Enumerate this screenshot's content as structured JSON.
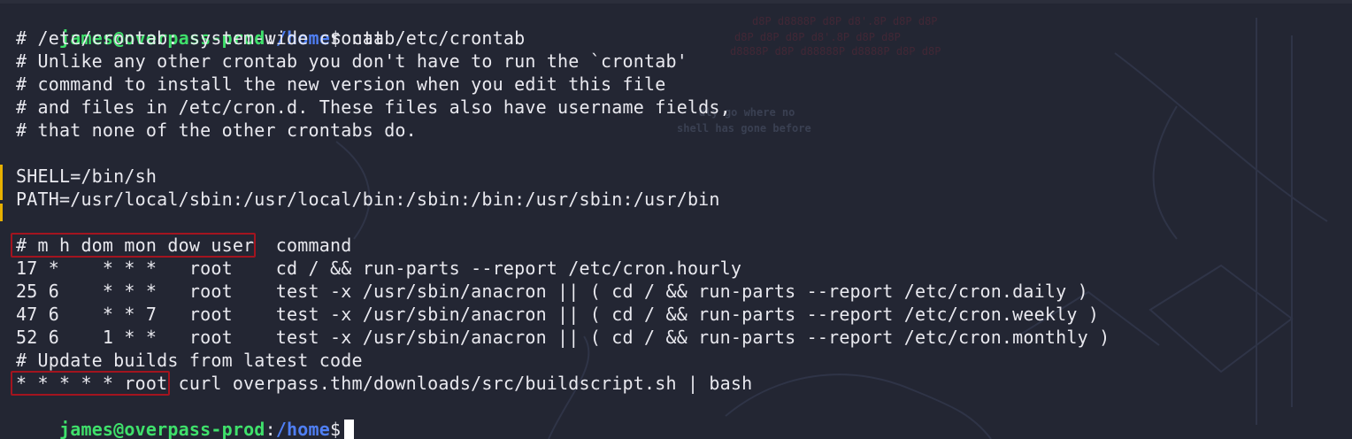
{
  "terminal": {
    "prompt": {
      "user_host": "james@overpass-prod",
      "separator": ":",
      "path": "/home",
      "symbol": "$"
    },
    "command": " cat /etc/crontab",
    "output": [
      "# /etc/crontab: system-wide crontab",
      "# Unlike any other crontab you don't have to run the `crontab'",
      "# command to install the new version when you edit this file",
      "# and files in /etc/cron.d. These files also have username fields,",
      "# that none of the other crontabs do.",
      "",
      "SHELL=/bin/sh",
      "PATH=/usr/local/sbin:/usr/local/bin:/sbin:/bin:/usr/sbin:/usr/bin",
      "",
      "# m h dom mon dow user  command",
      "17 *    * * *   root    cd / && run-parts --report /etc/cron.hourly",
      "25 6    * * *   root    test -x /usr/sbin/anacron || ( cd / && run-parts --report /etc/cron.daily )",
      "47 6    * * 7   root    test -x /usr/sbin/anacron || ( cd / && run-parts --report /etc/cron.weekly )",
      "52 6    1 * *   root    test -x /usr/sbin/anacron || ( cd / && run-parts --report /etc/cron.monthly )",
      "# Update builds from latest code",
      "* * * * * root curl overpass.thm/downloads/src/buildscript.sh | bash"
    ],
    "highlights": [
      {
        "name": "highlight-crontab-header",
        "text": "# m h dom mon dow user"
      },
      {
        "name": "highlight-root-job",
        "text": "* * * * * root"
      }
    ],
    "background_text": [
      "dly go where no",
      "shell has gone before"
    ]
  },
  "colors": {
    "background": "#232633",
    "prompt_user": "#3fe06b",
    "prompt_path": "#4f7ff4",
    "text": "#e9e9ef",
    "highlight_border": "#a3141f"
  }
}
